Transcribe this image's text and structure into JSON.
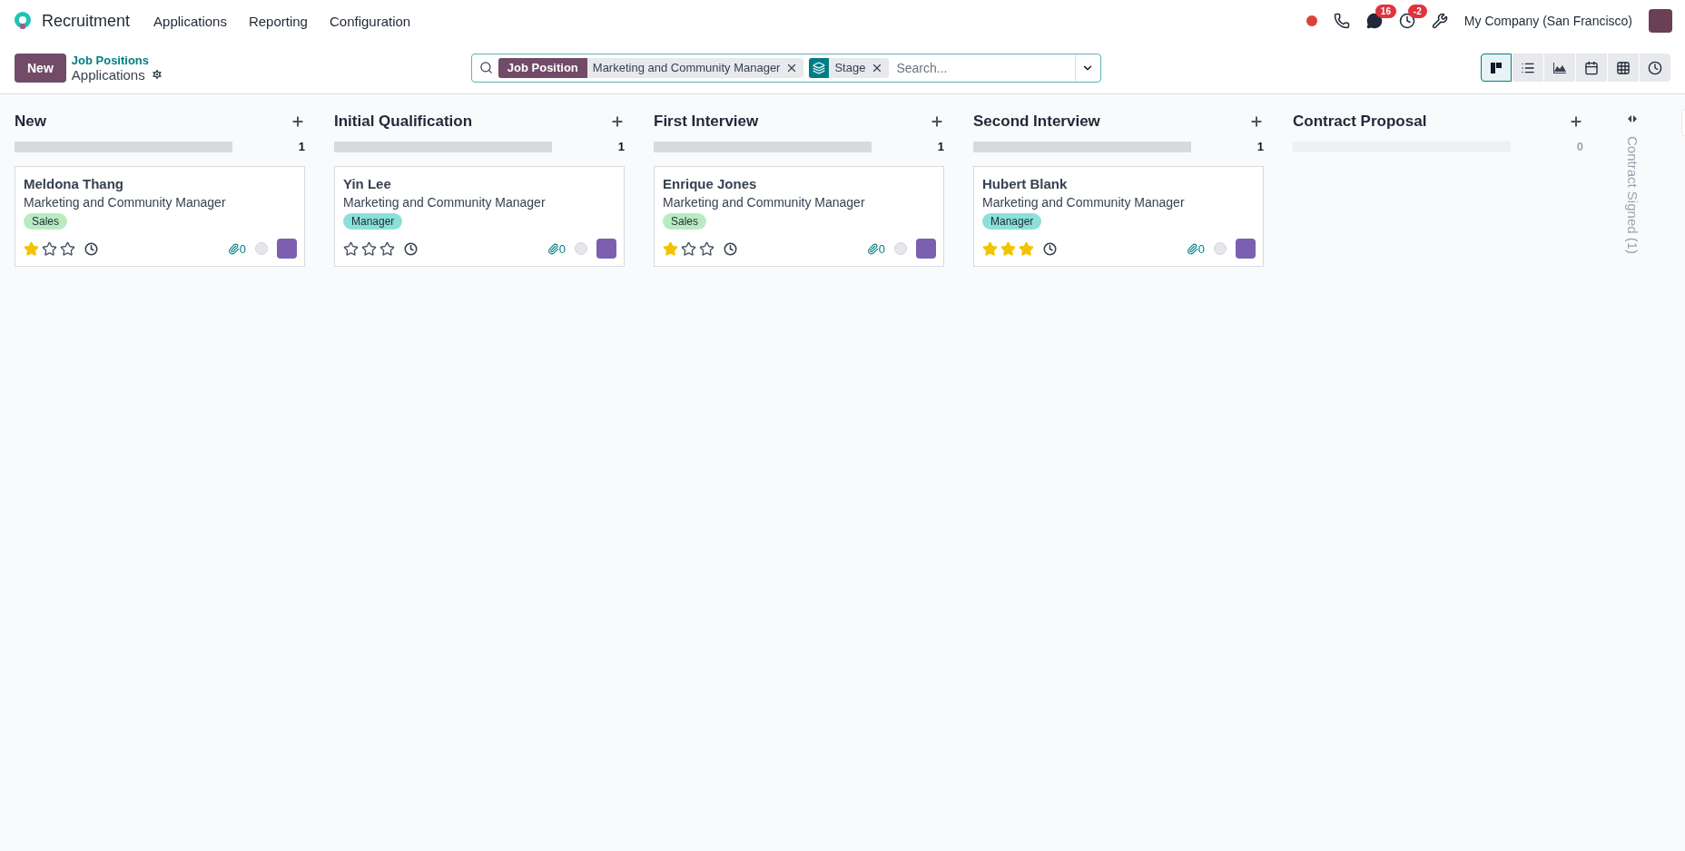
{
  "navbar": {
    "app_name": "Recruitment",
    "menus": [
      "Applications",
      "Reporting",
      "Configuration"
    ],
    "systray": {
      "chat_badge": "16",
      "activity_badge": "-2",
      "company": "My Company (San Francisco)"
    }
  },
  "control_panel": {
    "new_button": "New",
    "breadcrumb": "Job Positions",
    "title": "Applications",
    "search": {
      "facets": [
        {
          "kind": "label",
          "label": "Job Position",
          "value": "Marketing and Community Manager"
        },
        {
          "kind": "icon",
          "value": "Stage"
        }
      ],
      "placeholder": "Search..."
    },
    "views": [
      {
        "kind": "kanban",
        "selected": true
      },
      {
        "kind": "list",
        "selected": false
      },
      {
        "kind": "graph",
        "selected": false
      },
      {
        "kind": "calendar",
        "selected": false
      },
      {
        "kind": "pivot",
        "selected": false
      },
      {
        "kind": "activity",
        "selected": false
      }
    ]
  },
  "columns": [
    {
      "title": "New",
      "count": "1",
      "level": 0,
      "cards": [
        {
          "name": "Meldona Thang",
          "job": "Marketing and Community Manager",
          "tag": "Sales",
          "color": "#b8ecc0",
          "stars": 1,
          "attachments": "0"
        }
      ]
    },
    {
      "title": "Initial Qualification",
      "count": "1",
      "level": 0,
      "cards": [
        {
          "name": "Yin Lee",
          "job": "Marketing and Community Manager",
          "tag": "Manager",
          "color": "#8be0d9",
          "stars": 0,
          "attachments": "0"
        }
      ]
    },
    {
      "title": "First Interview",
      "count": "1",
      "level": 0,
      "cards": [
        {
          "name": "Enrique Jones",
          "job": "Marketing and Community Manager",
          "tag": "Sales",
          "color": "#b8ecc0",
          "stars": 1,
          "attachments": "0"
        }
      ]
    },
    {
      "title": "Second Interview",
      "count": "1",
      "level": 0,
      "cards": [
        {
          "name": "Hubert Blank",
          "job": "Marketing and Community Manager",
          "tag": "Manager",
          "color": "#8be0d9",
          "stars": 3,
          "attachments": "0"
        }
      ]
    },
    {
      "title": "Contract Proposal",
      "count": "0",
      "level": 0
    }
  ],
  "folded_column": "Contract Signed (1)"
}
